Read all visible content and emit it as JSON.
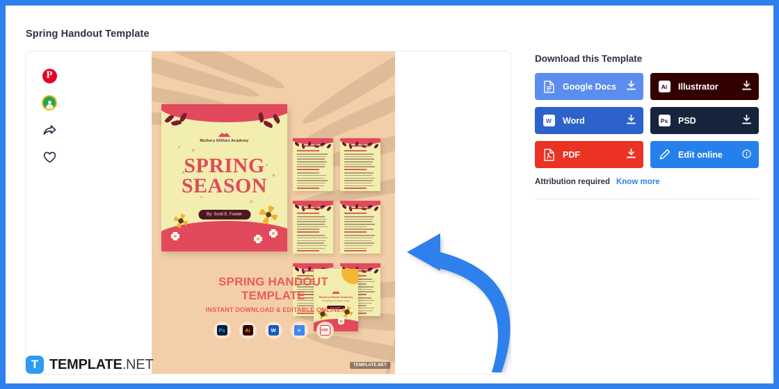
{
  "theme": {
    "frame_blue": "#2f80ed",
    "accent_link": "#2f80ed",
    "google_docs_bg": "#5b8def",
    "word_bg": "#2c62c9",
    "pdf_bg": "#ea3323",
    "illustrator_bg": "#330000",
    "psd_bg": "#16253d",
    "edit_online_bg": "#2680eb",
    "poster_bg": "#f2cfa8",
    "poster_accent": "#e2495c"
  },
  "page_title": "Spring Handout Template",
  "sidebar": {
    "items": [
      {
        "name": "pinterest-icon",
        "glyph": "P"
      },
      {
        "name": "envato-icon",
        "glyph": ""
      },
      {
        "name": "share-icon",
        "glyph": ""
      },
      {
        "name": "favorite-icon",
        "glyph": ""
      }
    ]
  },
  "poster": {
    "cover": {
      "academy": "Mulbery Elkhart Academy",
      "title_line1": "SPRING",
      "title_line2": "SEASON",
      "byline": "By: Scott E. Fowler"
    },
    "caption_line1": "SPRING HANDOUT",
    "caption_line2": "TEMPLATE",
    "caption_sub": "INSTANT DOWNLOAD & EDITABLE ONLINE",
    "app_icons": [
      {
        "name": "photoshop-icon",
        "label": "Ps"
      },
      {
        "name": "illustrator-icon",
        "label": "Ai"
      },
      {
        "name": "word-icon",
        "label": "W"
      },
      {
        "name": "google-docs-icon",
        "label": "≡"
      },
      {
        "name": "pdf-icon",
        "label": "PDF"
      }
    ],
    "watermark": "TEMPLATE.NET",
    "back_page": {
      "title": "Mulbery Elkhart Academy",
      "subtitle": "Get Handouts On Season To Date"
    }
  },
  "download": {
    "heading": "Download this Template",
    "buttons": [
      {
        "label": "Google Docs",
        "icon": "google-docs-icon",
        "badge": "",
        "action": "download"
      },
      {
        "label": "Illustrator",
        "icon": "illustrator-icon",
        "badge": "Ai",
        "action": "download"
      },
      {
        "label": "Word",
        "icon": "word-icon",
        "badge": "W",
        "action": "download"
      },
      {
        "label": "PSD",
        "icon": "photoshop-icon",
        "badge": "Ps",
        "action": "download"
      },
      {
        "label": "PDF",
        "icon": "pdf-icon",
        "badge": "",
        "action": "download"
      },
      {
        "label": "Edit online",
        "icon": "pencil-icon",
        "badge": "",
        "action": "info"
      }
    ],
    "attribution_text": "Attribution required",
    "attribution_link": "Know more"
  },
  "footer": {
    "logo_mark": "T",
    "logo_name": "TEMPLATE",
    "logo_tld": ".NET"
  }
}
